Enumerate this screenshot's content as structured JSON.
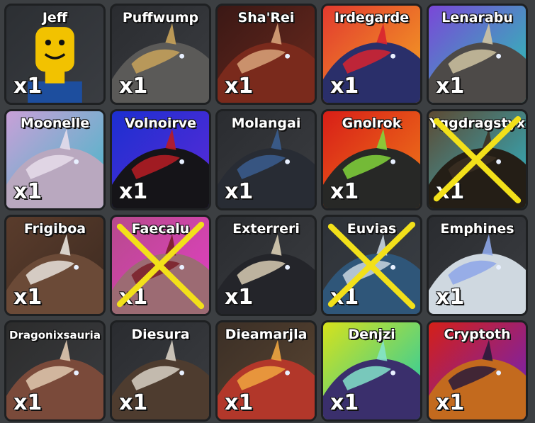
{
  "slots": [
    {
      "name": "Jeff",
      "qty": "x1",
      "bg": [
        "#2c2f33",
        "#3a3d42"
      ],
      "body": "#f2c200",
      "accent": "#1d4e9e",
      "crossed": false
    },
    {
      "name": "Puffwump",
      "qty": "x1",
      "bg": [
        "#2a2c30",
        "#3b3d41"
      ],
      "body": "#5b5a58",
      "accent": "#c9a35a",
      "crossed": false
    },
    {
      "name": "Sha'Rei",
      "qty": "x1",
      "bg": [
        "#3b1815",
        "#6b2a1e"
      ],
      "body": "#7a2a1c",
      "accent": "#d8a37a",
      "crossed": false
    },
    {
      "name": "Irdegarde",
      "qty": "x1",
      "bg": [
        "#e23a2f",
        "#f5a623"
      ],
      "body": "#2a2f6a",
      "accent": "#d8232f",
      "crossed": false
    },
    {
      "name": "Lenarabu",
      "qty": "x1",
      "bg": [
        "#7a47d8",
        "#27c9b1"
      ],
      "body": "#4d4a48",
      "accent": "#cfc3a2",
      "crossed": false
    },
    {
      "name": "Moonelle",
      "qty": "x1",
      "bg": [
        "#c9a0d8",
        "#3fb8c7"
      ],
      "body": "#b9a8bf",
      "accent": "#e6ddea",
      "crossed": false
    },
    {
      "name": "Volnoirve",
      "qty": "x1",
      "bg": [
        "#1c2fd0",
        "#5d2ad8"
      ],
      "body": "#151418",
      "accent": "#b91c24",
      "crossed": false
    },
    {
      "name": "Molangai",
      "qty": "x1",
      "bg": [
        "#2a2c30",
        "#3b3d41"
      ],
      "body": "#282c34",
      "accent": "#3a5d8f",
      "crossed": false
    },
    {
      "name": "Gnolrok",
      "qty": "x1",
      "bg": [
        "#d81e17",
        "#f07c1a"
      ],
      "body": "#272826",
      "accent": "#83d43b",
      "crossed": false
    },
    {
      "name": "Yggdragstyx",
      "qty": "x1",
      "bg": [
        "#5d4a33",
        "#2fb6c9"
      ],
      "body": "#241e16",
      "accent": "#3b2f22",
      "crossed": true
    },
    {
      "name": "Frigiboa",
      "qty": "x1",
      "bg": [
        "#5a3c2c",
        "#3c2a20"
      ],
      "body": "#6b4a37",
      "accent": "#e8e2dc",
      "crossed": false
    },
    {
      "name": "Faecalu",
      "qty": "x1",
      "bg": [
        "#b74a8c",
        "#e33fc5"
      ],
      "body": "#9c6b73",
      "accent": "#7a1e28",
      "crossed": true
    },
    {
      "name": "Exterreri",
      "qty": "x1",
      "bg": [
        "#2a2c30",
        "#3b3d41"
      ],
      "body": "#24252a",
      "accent": "#d8cdb4",
      "crossed": false
    },
    {
      "name": "Euvias",
      "qty": "x1",
      "bg": [
        "#2e3238",
        "#3b3f44"
      ],
      "body": "#2f5679",
      "accent": "#c9d6e1",
      "crossed": true
    },
    {
      "name": "Emphines",
      "qty": "x1",
      "bg": [
        "#2a2c30",
        "#3b3d41"
      ],
      "body": "#cfd8e0",
      "accent": "#8da6e8",
      "crossed": false
    },
    {
      "name": "Dragonixsauria",
      "qty": "x1",
      "bg": [
        "#2c2c2c",
        "#3b3d41"
      ],
      "body": "#7a4a3a",
      "accent": "#e0c9b0",
      "crossed": false
    },
    {
      "name": "Diesura",
      "qty": "x1",
      "bg": [
        "#2a2c30",
        "#3b3d41"
      ],
      "body": "#4e3c2f",
      "accent": "#d8d0c4",
      "crossed": false
    },
    {
      "name": "Dieamarjla",
      "qty": "x1",
      "bg": [
        "#3b2f26",
        "#5a4532"
      ],
      "body": "#b2372a",
      "accent": "#f0a640",
      "crossed": false
    },
    {
      "name": "Denjzi",
      "qty": "x1",
      "bg": [
        "#d6e21c",
        "#19c9b0"
      ],
      "body": "#3a2f6c",
      "accent": "#84e3c9",
      "crossed": false
    },
    {
      "name": "Cryptoth",
      "qty": "x1",
      "bg": [
        "#d42018",
        "#6a22c4"
      ],
      "body": "#c36a1e",
      "accent": "#2a1a3a",
      "crossed": false
    }
  ]
}
